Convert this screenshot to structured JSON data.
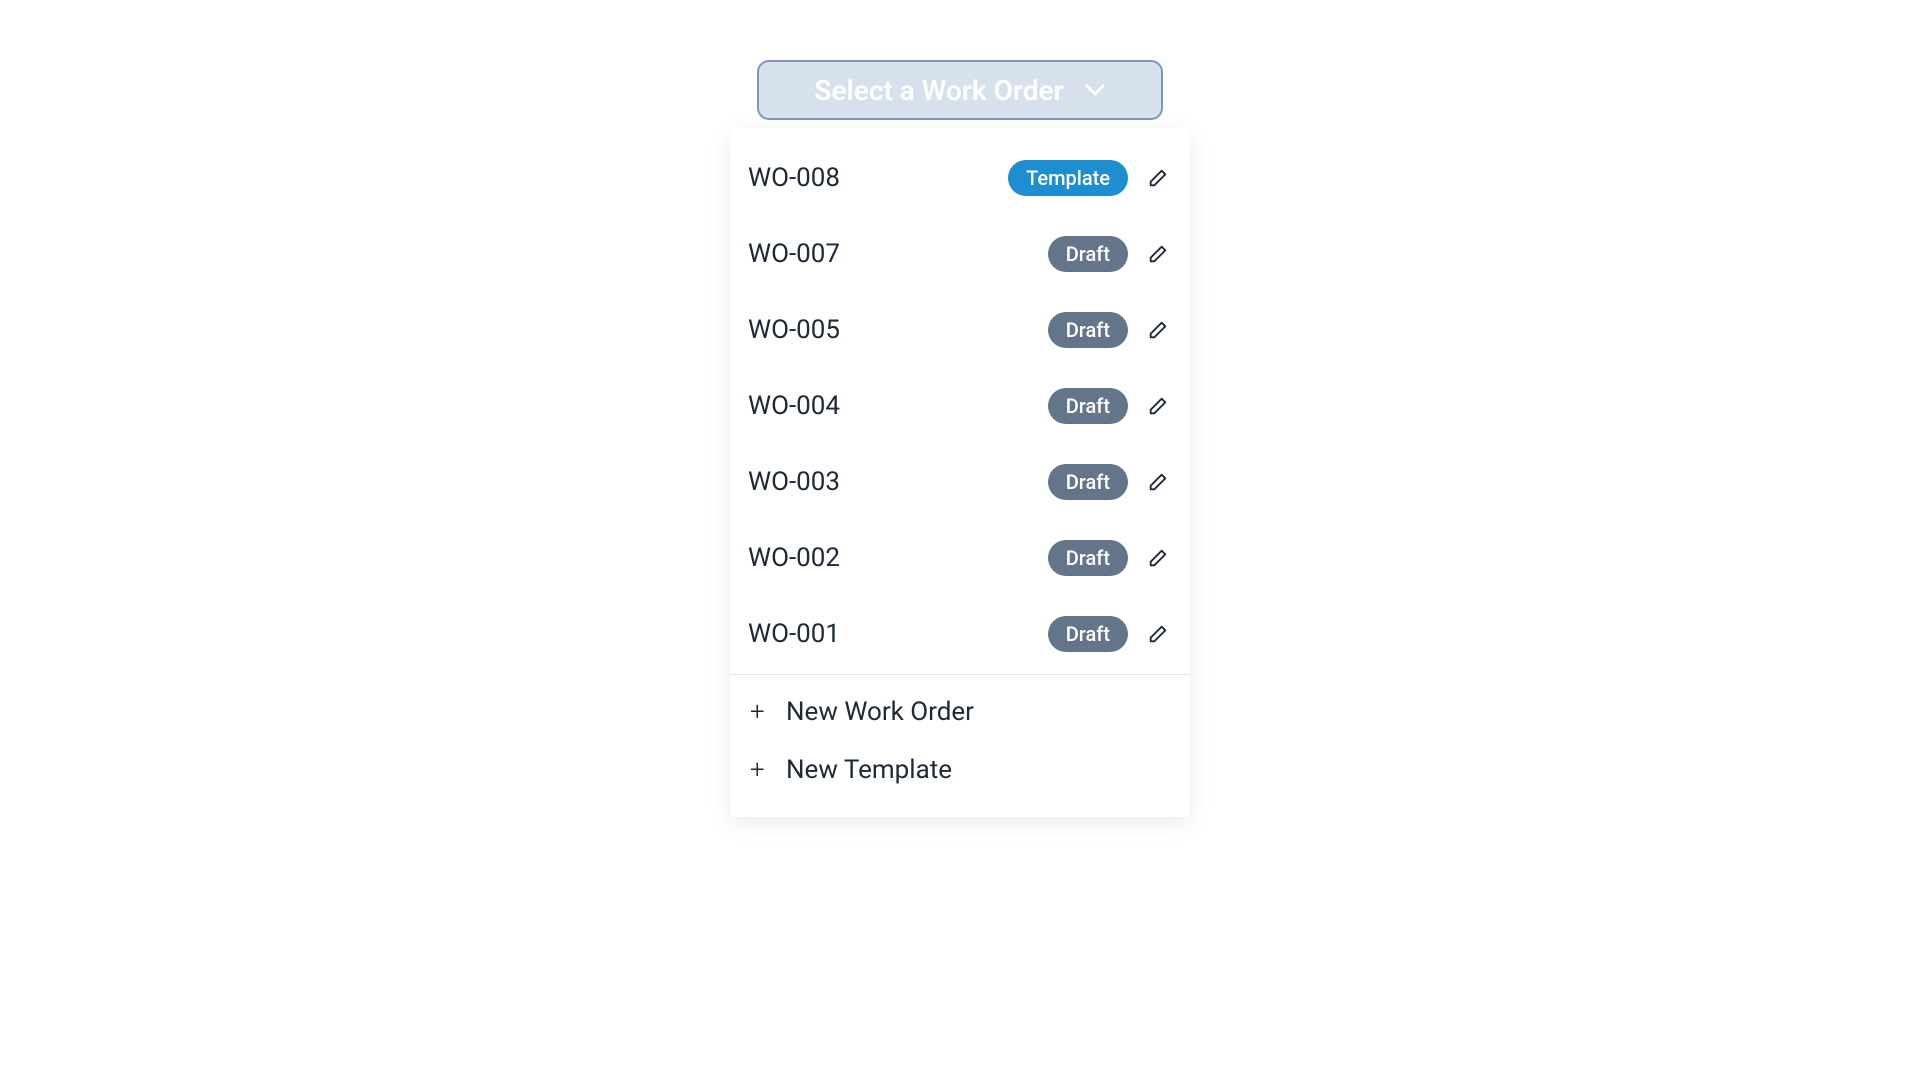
{
  "select": {
    "label": "Select a Work Order"
  },
  "items": [
    {
      "code": "WO-008",
      "status": "Template",
      "status_type": "template"
    },
    {
      "code": "WO-007",
      "status": "Draft",
      "status_type": "draft"
    },
    {
      "code": "WO-005",
      "status": "Draft",
      "status_type": "draft"
    },
    {
      "code": "WO-004",
      "status": "Draft",
      "status_type": "draft"
    },
    {
      "code": "WO-003",
      "status": "Draft",
      "status_type": "draft"
    },
    {
      "code": "WO-002",
      "status": "Draft",
      "status_type": "draft"
    },
    {
      "code": "WO-001",
      "status": "Draft",
      "status_type": "draft"
    }
  ],
  "actions": {
    "new_work_order": "New Work Order",
    "new_template": "New Template"
  }
}
